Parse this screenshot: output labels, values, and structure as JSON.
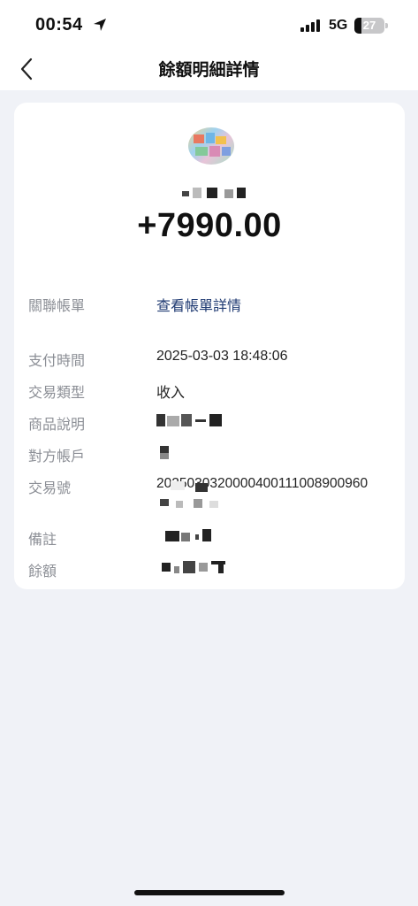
{
  "status_bar": {
    "time": "00:54",
    "network": "5G",
    "battery": "27"
  },
  "nav": {
    "title": "餘額明細詳情",
    "back_icon": "chevron-left-icon"
  },
  "transaction": {
    "amount": "+7990.00",
    "rows": {
      "linked_bill": {
        "label": "關聯帳單",
        "value": "查看帳單詳情"
      },
      "pay_time": {
        "label": "支付時間",
        "value": "2025-03-03 18:48:06"
      },
      "type": {
        "label": "交易類型",
        "value": "收入"
      },
      "description": {
        "label": "商品說明"
      },
      "counterparty": {
        "label": "對方帳戶"
      },
      "txn_no": {
        "label": "交易號",
        "value": "2025030320000400111008900960"
      },
      "remark": {
        "label": "備註"
      },
      "balance": {
        "label": "餘額"
      }
    }
  },
  "colors": {
    "background": "#f0f2f7",
    "link": "#1f3a72",
    "label": "#8c8f96"
  }
}
